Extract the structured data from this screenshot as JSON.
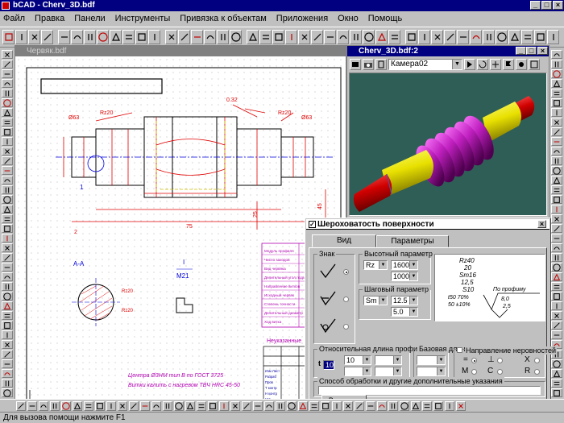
{
  "app": {
    "title": "bCAD - Cherv_3D.bdf"
  },
  "menu": [
    "Файл",
    "Правка",
    "Панели",
    "Инструменты",
    "Привязка к объектам",
    "Приложения",
    "Окно",
    "Помощь"
  ],
  "drawing_window": {
    "title": "Червяк.bdf",
    "dims": {
      "d63_left": "Ø63",
      "ra20_left": "Rz20",
      "d32": "0.32",
      "ra20_right": "Rz20",
      "d63_right": "Ø63",
      "label_1": "1",
      "label_2": "2",
      "sec_a": "A-A",
      "rz20_a": "Rz20",
      "rz20_b": "Rz20",
      "view_i": "I",
      "m21": "M21",
      "d25": "25",
      "d75": "75",
      "d45": "45"
    },
    "notes": {
      "line1": "Центра  Ø3НМ  тип  В  по  ГОСТ  3725",
      "line2": "Витки  калить  с  нагревом  ТВЧ  HRC  45-50"
    },
    "table_rows": [
      "Модуль профиля",
      "Число заходов",
      "Вид червяка",
      "Делительный угол подъема",
      "Направление витков",
      "Исходный червяк",
      "Степень точности",
      "Делительный диаметр",
      "Ход витка"
    ],
    "stamp": {
      "title": "Неуказанные",
      "row_labels": [
        "Изм Лист",
        "Разраб",
        "Пров",
        "Т контр",
        "Н контр",
        "Утв"
      ]
    }
  },
  "window_3d": {
    "title": "Cherv_3D.bdf:2",
    "camera": "Камера02"
  },
  "dialog": {
    "title": "Шероховатость поверхности",
    "tabs": [
      "Вид",
      "Параметры"
    ],
    "sign_group": "Знак",
    "height_group": "Высотный параметр",
    "height_param": "Rz",
    "height_val1": "1600",
    "height_val2": "1000",
    "step_group": "Шаговый параметр",
    "step_param": "Sm",
    "step_val1": "12.5",
    "step_val2": "5.0",
    "rel_len_group": "Относительная длина профиля",
    "rel_val1": "10",
    "rel_val2": "10",
    "base_len_group": "Базовая длина",
    "direction_label": "Направление неровностей",
    "dir_options": [
      "=",
      "⊥",
      "X",
      "M",
      "C",
      "R"
    ],
    "method_label": "Способ обработки и другие дополнительные указания",
    "insert_button": "Вставить",
    "preview": {
      "l1": "Rz40",
      "l2": "20",
      "l3": "Sm16",
      "l4": "12,5",
      "l5": "S10",
      "l6": "S0,8",
      "l7": "t50 70%",
      "l8": "По профиму",
      "l9": "8,0",
      "l10": "50 ±10%",
      "l11": "2,5"
    }
  },
  "status": "Для вызова помощи нажмите F1"
}
